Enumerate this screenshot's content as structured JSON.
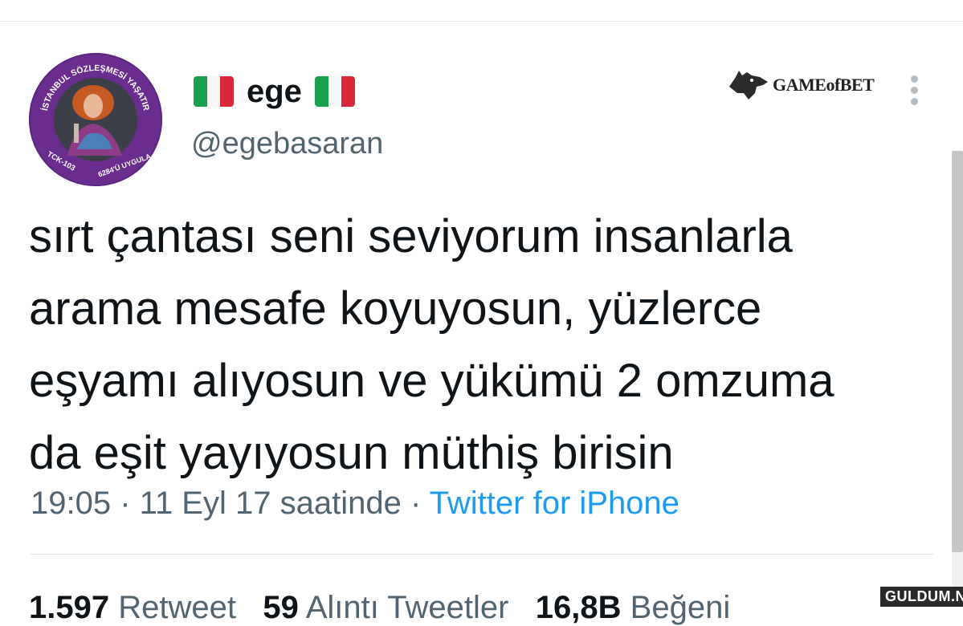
{
  "tweet": {
    "display_name": "ege",
    "handle": "@egebasaran",
    "text_lines": [
      "sırt çantası seni seviyorum insanlarla",
      "arama mesafe koyuyosun, yüzlerce",
      "eşyamı alıyosun ve yükümü 2 omzuma",
      "da eşit yayıyosun müthiş birisin"
    ],
    "time": "19:05",
    "date": "11 Eyl 17 saatinde",
    "source": "Twitter for iPhone"
  },
  "avatar_badge": {
    "top_text": "İSTANBUL SÖZLEŞMESİ YAŞATIR",
    "bottom_left": "TCK-103",
    "bottom_right": "6284'Ü UYGULA"
  },
  "brand_logo": "GAMEofBET",
  "stats": [
    {
      "count": "1.597",
      "label": "Retweet"
    },
    {
      "count": "59",
      "label": "Alıntı Tweetler"
    },
    {
      "count": "16,8B",
      "label": "Beğeni"
    }
  ],
  "watermark": "GULDUM.NET",
  "colors": {
    "text": "#0f1419",
    "muted": "#536471",
    "link": "#1d9bf0",
    "avatar_ring": "#6a2d8e"
  },
  "icons": [
    "italy-flag-icon",
    "wolf-icon",
    "kebab-menu-icon"
  ]
}
